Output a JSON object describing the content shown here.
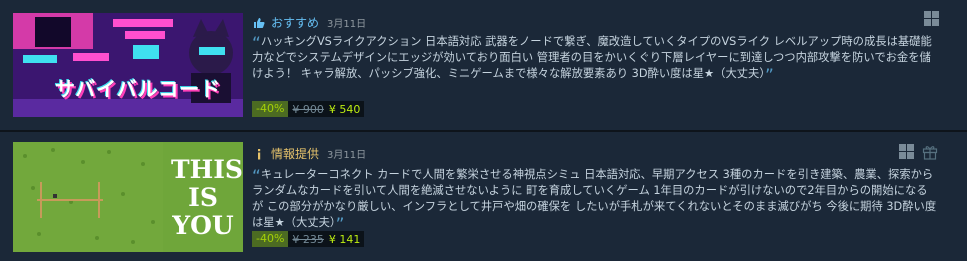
{
  "items": [
    {
      "tag": "おすすめ",
      "date": "3月11日",
      "thumb_text": "サバイバルコード",
      "review": "ハッキングVSライクアクション 日本語対応 武器をノードで繋ぎ、魔改造していくタイプのVSライク レベルアップ時の成長は基礎能力などでシステムデザインにエッジが効いており面白い 管理者の目をかいくぐり下層レイヤーに到達しつつ内部攻撃を防いでお金を儲けよう！ キャラ解放、パッシブ強化、ミニゲームまで様々な解放要素あり 3D酔い度は星★（大丈夫）",
      "discount": "-40%",
      "original_price": "¥ 900",
      "final_price": "¥ 540",
      "tag_icon": "thumbs-up-icon",
      "platform_icon": "windows-icon"
    },
    {
      "tag": "情報提供",
      "date": "3月11日",
      "thumb_text": [
        "THIS",
        "IS",
        "YOU"
      ],
      "review": "キュレーターコネクト カードで人間を繁栄させる神視点シミュ 日本語対応、早期アクセス 3種のカードを引き建築、農業、探索から ランダムなカードを引いて人間を絶滅させないように 町を育成していくゲーム 1年目のカードが引けないので2年目からの開始になるが この部分がかなり厳しい、インフラとして井戸や畑の確保を したいが手札が来てくれないとそのまま滅びがち 今後に期待 3D酔い度は星★（大丈夫）",
      "discount": "-40%",
      "original_price": "¥ 235",
      "final_price": "¥ 141",
      "tag_icon": "info-icon",
      "platform_icon": "windows-icon",
      "extra_icon": "gift-icon"
    }
  ],
  "colors": {
    "accent": "#66c0f4",
    "info": "#e5c26b",
    "discount_bg": "#4c6b22",
    "discount_text": "#a4d007",
    "price": "#beee11"
  }
}
